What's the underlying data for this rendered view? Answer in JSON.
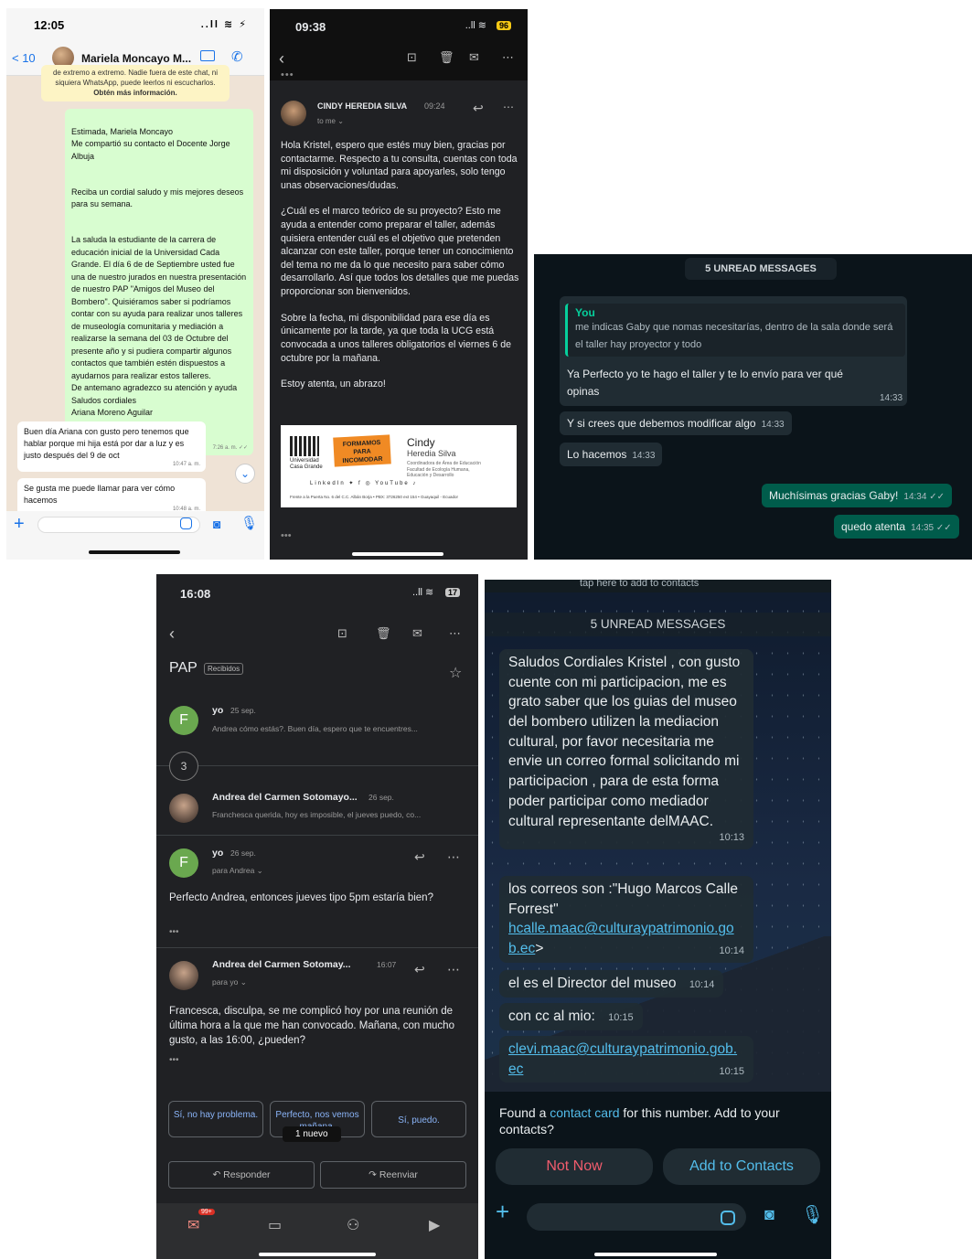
{
  "p1": {
    "time": "12:05",
    "status_icons": "..ll ≋ ⚡",
    "back": "< 10",
    "contact": "Mariela Moncayo M...",
    "notice": "de extremo a extremo. Nadie fuera de este chat, ni siquiera WhatsApp, puede leerlos ni escucharlos.",
    "notice_link": "Obtén más información.",
    "out_paragraphs": [
      "Estimada, Mariela Moncayo\nMe compartió su contacto el Docente Jorge Albuja",
      "Reciba un cordial saludo y mis mejores deseos para su semana.",
      "La saluda la estudiante de la carrera de educación inicial de la Universidad Cada Grande. El día 6 de de Septiembre usted fue una de nuestro jurados en nuestra presentación de nuestro PAP \"Amigos del Museo del Bombero\". Quisiéramos saber si podríamos contar con su ayuda para realizar unos talleres de museología comunitaria y mediación a realizarse la semana del 03 de Octubre del presente año y si pudiera compartir algunos contactos que también estén dispuestos a ayudarnos para realizar estos talleres.\n De antemano agradezco su atención y ayuda\nSaludos cordiales\nAriana Moreno Aguilar"
    ],
    "out_time": "7:26 a. m. ✓✓",
    "in1": "Buen día Ariana con gusto pero tenemos que hablar porque mi hija está por dar a luz y es justo después del 9 de oct",
    "in1_time": "10:47 a. m.",
    "in2": "Se gusta me puede llamar para ver cómo hacemos",
    "in2_time": "10:48 a. m."
  },
  "p2": {
    "time": "09:38",
    "signal": "..ll ≋",
    "battery": "96",
    "sender": "CINDY HEREDIA SILVA",
    "sent_time": "09:24",
    "to": "to me ⌄",
    "paragraphs": [
      "Hola Kristel, espero que estés muy bien, gracias por contactarme. Respecto a tu consulta, cuentas con toda mi disposición y voluntad para apoyarles, solo tengo unas observaciones/dudas.",
      "¿Cuál es el marco teórico de su proyecto? Esto me ayuda a entender como preparar el taller, además quisiera entender cuál es el objetivo que pretenden alcanzar con este taller, porque tener un conocimiento del tema no me da lo que necesito para saber cómo desarrollarlo. Así que todos los detalles que me puedas proporcionar son bienvenidos.",
      "Sobre la fecha, mi disponibilidad para ese día es únicamente por la tarde, ya que toda la UCG está convocada a unos talleres obligatorios el viernes 6 de octubre por la mañana.",
      "Estoy atenta, un abrazo!"
    ],
    "signature": {
      "university": "Universidad\nCasa Grande",
      "badge": "FORMAMOS PARA\nINCOMODAR",
      "first": "Cindy",
      "last": "Heredia Silva",
      "role": "Coordinadora de Área de Educación\nFacultad de Ecología Humana,\nEducación y Desarrollo",
      "socials": "LinkedIn  ✦  f  ◎  YouTube  ♪",
      "address": "Frente a la Puerta No. 6 del C.C. Albán Borja  •  PBX: 3726250 ext 154  •  Guayaquil - Ecuador"
    }
  },
  "p3": {
    "unread": "5 UNREAD MESSAGES",
    "quote_author": "You",
    "quote_text": "me indicas Gaby que nomas necesitarías, dentro de la sala donde será el taller hay proyector y todo",
    "messages": [
      {
        "text": "Ya Perfecto yo te hago el taller y te lo envío para ver qué opinas",
        "time": "14:33"
      },
      {
        "text": "Y si crees que debemos modificar algo",
        "time": "14:33"
      },
      {
        "text": "Lo hacemos",
        "time": "14:33"
      },
      {
        "text": "Muchísimas gracias Gaby!",
        "time": "14:34 ✓✓"
      },
      {
        "text": "quedo atenta",
        "time": "14:35 ✓✓"
      }
    ]
  },
  "p4": {
    "time": "16:08",
    "signal": "..ll ≋",
    "battery": "17",
    "subject": "PAP",
    "label": "Recibidos",
    "t1": {
      "avatar": "F",
      "name": "yo",
      "date": "25 sep.",
      "snippet": "Andrea cómo estás?. Buen día, espero que te encuentres..."
    },
    "count": "3",
    "t2": {
      "name": "Andrea del Carmen Sotomayo...",
      "date": "26 sep.",
      "snippet": "Franchesca querida, hoy es imposible, el jueves puedo, co..."
    },
    "t3": {
      "avatar": "F",
      "name": "yo",
      "date": "26 sep.",
      "to": "para Andrea ⌄",
      "body": "Perfecto Andrea, entonces jueves tipo 5pm estaría bien?"
    },
    "t4": {
      "name": "Andrea del Carmen Sotomay...",
      "date": "16:07",
      "to": "para yo ⌄",
      "body": "Francesca, disculpa, se me complicó hoy por una reunión de última hora a la que me han convocado. Mañana, con mucho gusto, a las 16:00, ¿pueden?"
    },
    "smart_replies": [
      "Sí, no hay problema.",
      "Perfecto, nos vemos mañana.",
      "Sí, puedo."
    ],
    "nuevo": "1 nuevo",
    "reply": "↶  Responder",
    "forward": "↷  Reenviar",
    "badge": "99+"
  },
  "p5": {
    "header": "tap here to add to contacts",
    "unread": "5 UNREAD MESSAGES",
    "m1": "Saludos Cordiales Kristel , con gusto cuente con mi participacion, me es grato saber que los guias del museo del bombero utilizen la mediacion cultural, por favor necesitaria me envie un correo formal solicitando mi participacion , para de esta forma poder participar como mediador cultural representante delMAAC.",
    "m1_time": "10:13",
    "m2a": "los correos son :\"Hugo Marcos Calle Forrest\"",
    "m2_link": "hcalle.maac@culturaypatrimonio.gob.ec",
    "m2b": ">",
    "m2_time": "10:14",
    "m3": "el es el Director del museo",
    "m3_time": "10:14",
    "m4": "con cc al mio:",
    "m4_time": "10:15",
    "m5_link": "clevi.maac@culturaypatrimonio.gob.ec",
    "m5_time": "10:15",
    "found_pre": "Found a ",
    "found_link": "contact card",
    "found_post": " for this number. Add to your contacts?",
    "not_now": "Not Now",
    "add": "Add to Contacts",
    "colors": {
      "danger": "#f15c6d",
      "link": "#53bdeb"
    }
  }
}
